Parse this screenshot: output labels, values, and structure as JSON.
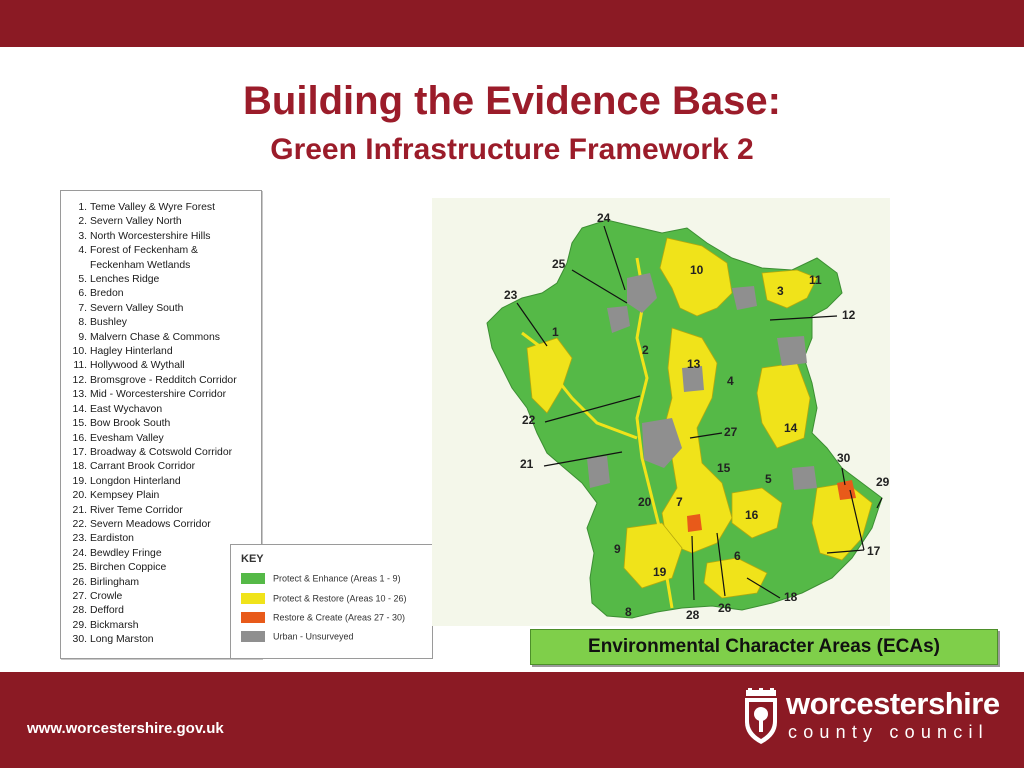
{
  "title": "Building the Evidence Base:",
  "subtitle": "Green Infrastructure Framework 2",
  "areas": [
    {
      "num": "1.",
      "name": "Teme Valley & Wyre Forest"
    },
    {
      "num": "2.",
      "name": "Severn Valley North"
    },
    {
      "num": "3.",
      "name": "North Worcestershire Hills"
    },
    {
      "num": "4.",
      "name": "Forest of Feckenham &",
      "cont": "Feckenham Wetlands"
    },
    {
      "num": "5.",
      "name": "Lenches Ridge"
    },
    {
      "num": "6.",
      "name": "Bredon"
    },
    {
      "num": "7.",
      "name": "Severn Valley South"
    },
    {
      "num": "8.",
      "name": "Bushley"
    },
    {
      "num": "9.",
      "name": "Malvern Chase & Commons"
    },
    {
      "num": "10.",
      "name": "Hagley Hinterland"
    },
    {
      "num": "11.",
      "name": "Hollywood & Wythall"
    },
    {
      "num": "12.",
      "name": "Bromsgrove - Redditch Corridor"
    },
    {
      "num": "13.",
      "name": "Mid - Worcestershire Corridor"
    },
    {
      "num": "14.",
      "name": "East Wychavon"
    },
    {
      "num": "15.",
      "name": "Bow Brook South"
    },
    {
      "num": "16.",
      "name": "Evesham Valley"
    },
    {
      "num": "17.",
      "name": "Broadway & Cotswold Corridor"
    },
    {
      "num": "18.",
      "name": "Carrant Brook Corridor"
    },
    {
      "num": "19.",
      "name": "Longdon Hinterland"
    },
    {
      "num": "20.",
      "name": "Kempsey Plain"
    },
    {
      "num": "21.",
      "name": "River Teme Corridor"
    },
    {
      "num": "22.",
      "name": "Severn Meadows Corridor"
    },
    {
      "num": "23.",
      "name": "Eardiston"
    },
    {
      "num": "24.",
      "name": "Bewdley Fringe"
    },
    {
      "num": "25.",
      "name": "Birchen Coppice"
    },
    {
      "num": "26.",
      "name": "Birlingham"
    },
    {
      "num": "27.",
      "name": "Crowle"
    },
    {
      "num": "28.",
      "name": "Defford"
    },
    {
      "num": "29.",
      "name": "Bickmarsh"
    },
    {
      "num": "30.",
      "name": "Long Marston"
    }
  ],
  "key": {
    "title": "KEY",
    "items": [
      {
        "label": "Protect & Enhance (Areas 1 - 9)",
        "color": "#55b947"
      },
      {
        "label": "Protect & Restore (Areas 10 - 26)",
        "color": "#f0e31a"
      },
      {
        "label": "Restore & Create (Areas 27 - 30)",
        "color": "#e85a1a"
      },
      {
        "label": "Urban - Unsurveyed",
        "color": "#8f8f8f"
      }
    ]
  },
  "map": {
    "labels": [
      "1",
      "2",
      "3",
      "4",
      "5",
      "6",
      "7",
      "8",
      "9",
      "10",
      "11",
      "12",
      "13",
      "14",
      "15",
      "16",
      "17",
      "18",
      "19",
      "20",
      "21",
      "22",
      "23",
      "24",
      "25",
      "26",
      "27",
      "28",
      "29",
      "30"
    ]
  },
  "map_caption": "Environmental Character  Areas (ECAs)",
  "footer": {
    "url": "www.worcestershire.gov.uk",
    "logo_word": "worcestershire",
    "logo_sub": "county council"
  },
  "colors": {
    "brand": "#8b1a24",
    "title": "#9b1c2a",
    "caption_bg": "#7fcf4a"
  }
}
